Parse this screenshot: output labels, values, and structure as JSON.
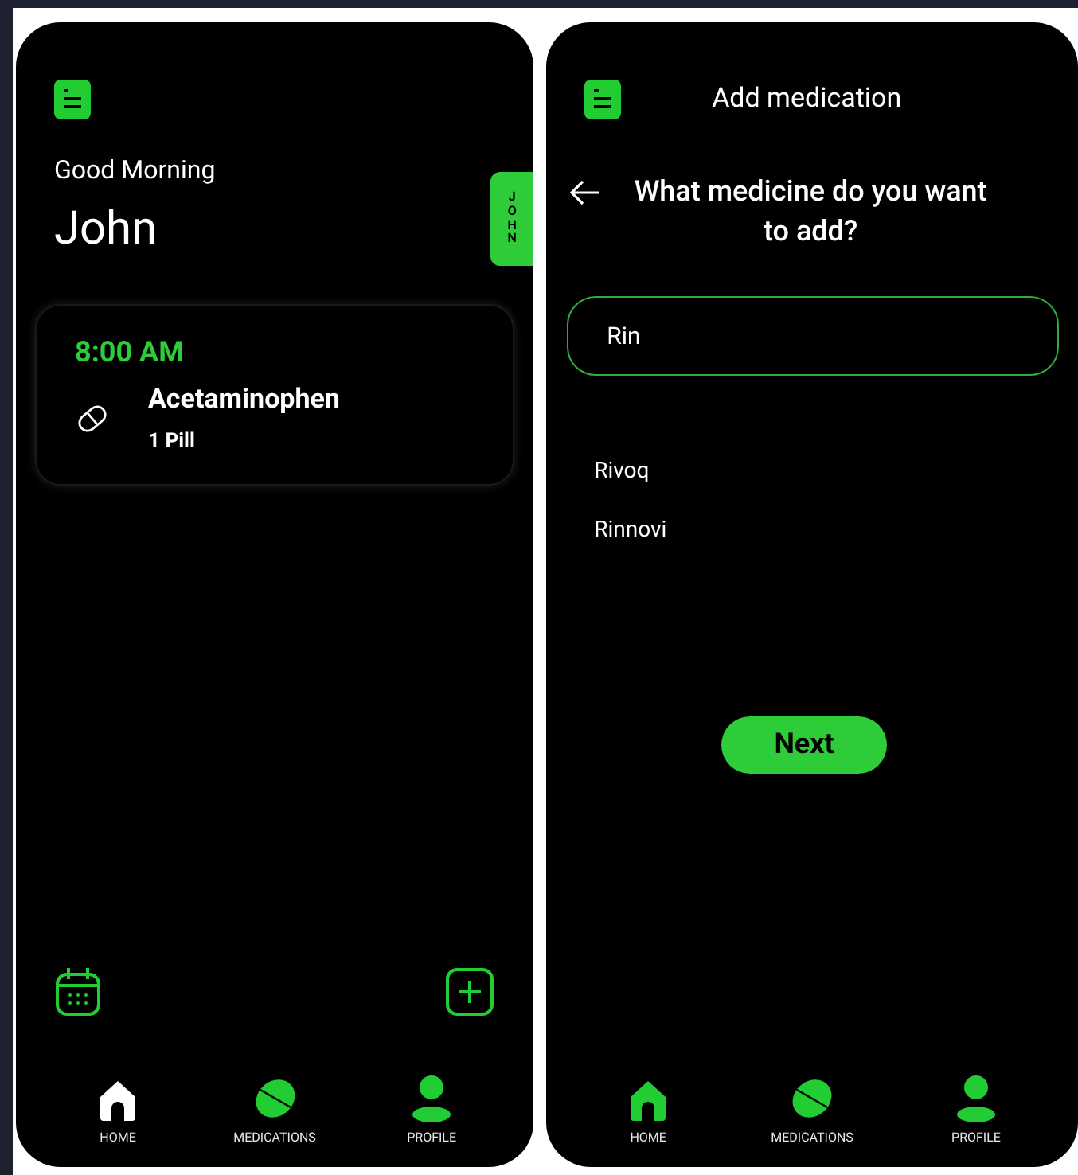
{
  "home_screen": {
    "greeting": "Good Morning",
    "name": "John",
    "side_tab": "JOHN",
    "doses": [
      {
        "time": "8:00 AM",
        "medicine": "Acetaminophen",
        "amount": "1 Pill"
      }
    ],
    "nav": [
      {
        "kind": "home",
        "label": "HOME",
        "selected": true
      },
      {
        "kind": "medications",
        "label": "MEDICATIONS",
        "selected": false
      },
      {
        "kind": "profile",
        "label": "PROFILE",
        "selected": false
      }
    ]
  },
  "add_screen": {
    "title": "Add medication",
    "question": "What medicine do you want to add?",
    "search": {
      "value": "Rin"
    },
    "suggestions": [
      "Rivoq",
      "Rinnovi"
    ],
    "next_button": "Next",
    "nav": [
      {
        "kind": "home",
        "label": "HOME",
        "selected": false
      },
      {
        "kind": "medications",
        "label": "MEDICATIONS",
        "selected": false
      },
      {
        "kind": "profile",
        "label": "PROFILE",
        "selected": false
      }
    ]
  }
}
